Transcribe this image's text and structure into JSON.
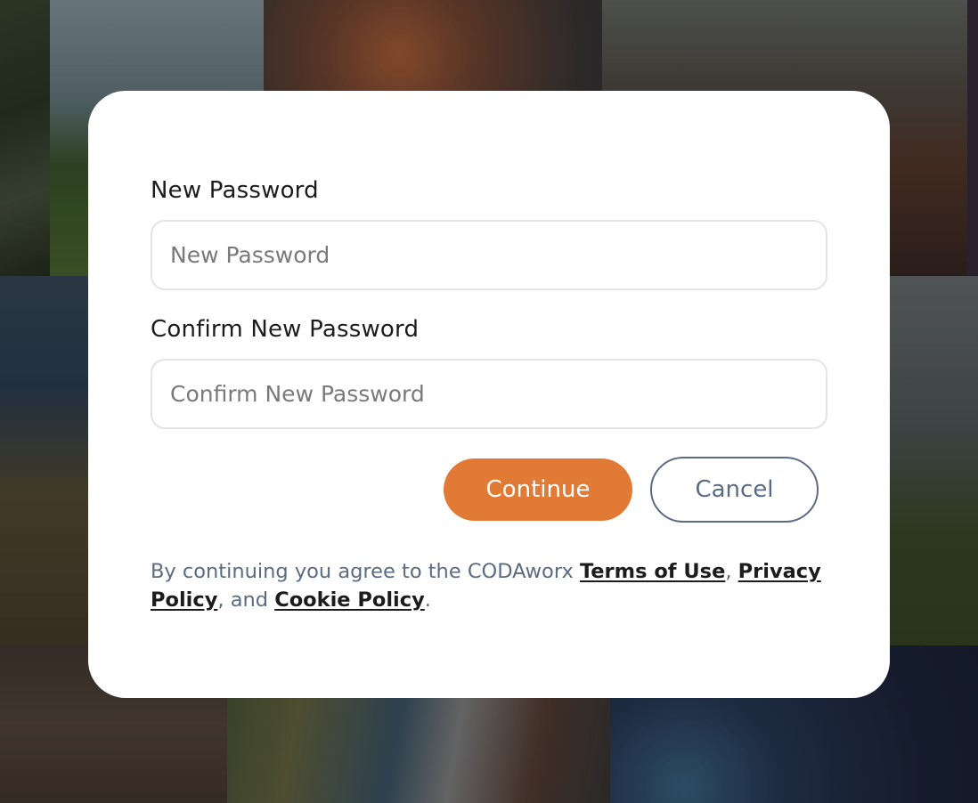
{
  "form": {
    "new_password": {
      "label": "New Password",
      "placeholder": "New Password",
      "value": ""
    },
    "confirm_password": {
      "label": "Confirm New Password",
      "placeholder": "Confirm New Password",
      "value": ""
    },
    "continue_label": "Continue",
    "cancel_label": "Cancel"
  },
  "legal": {
    "prefix": "By continuing you agree to the CODAworx ",
    "terms_link": "Terms of Use",
    "sep1": ", ",
    "privacy_link": "Privacy Policy",
    "sep2": ", and ",
    "cookie_link": "Cookie Policy",
    "suffix": "."
  },
  "colors": {
    "primary": "#e07a35",
    "secondary": "#5b6b82",
    "text": "#1c1c1c"
  }
}
